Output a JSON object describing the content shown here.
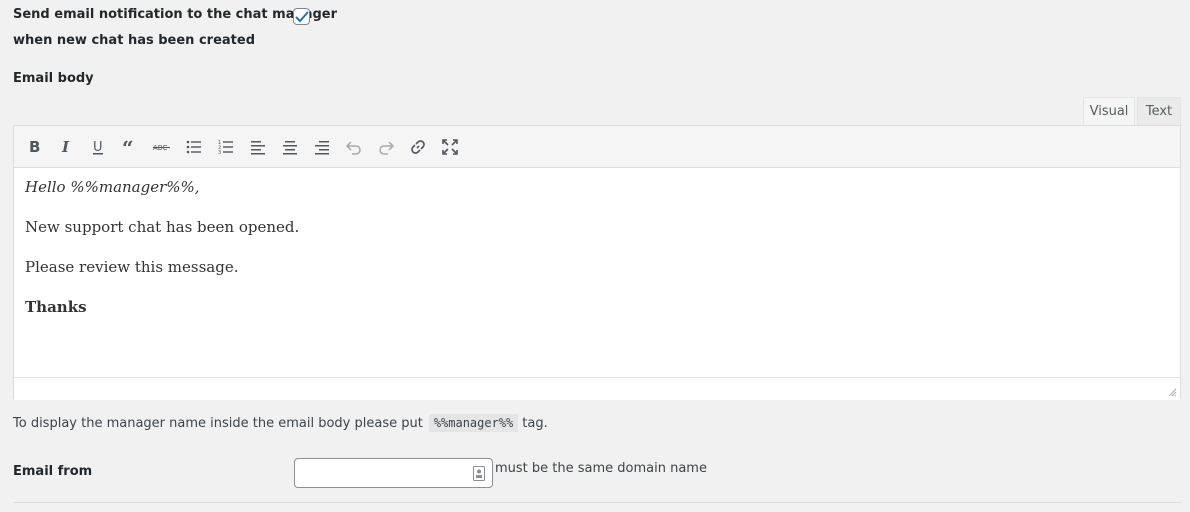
{
  "notification": {
    "label": "Send email notification to the chat manager",
    "sublabel": "when new chat has been created",
    "checked": true
  },
  "email_body": {
    "label": "Email body",
    "tabs": {
      "visual": "Visual",
      "text": "Text",
      "active": "Visual"
    },
    "toolbar": [
      "bold-icon",
      "italic-icon",
      "underline-icon",
      "blockquote-icon",
      "strikethrough-icon",
      "bullet-list-icon",
      "numbered-list-icon",
      "align-left-icon",
      "align-center-icon",
      "align-right-icon",
      "undo-icon",
      "redo-icon",
      "link-icon",
      "fullscreen-icon"
    ],
    "content": {
      "line1": "Hello %%manager%%,",
      "line2": "New support chat has been opened.",
      "line3": "Please review this message.",
      "line4": "Thanks"
    }
  },
  "help": {
    "before": "To display the manager name inside the email body please put",
    "code": "%%manager%%",
    "after": "tag."
  },
  "email_from": {
    "label": "Email from",
    "value": "",
    "hint": "must be the same domain name"
  },
  "colors": {
    "accent": "#2271b1",
    "background": "#f1f1f1"
  }
}
